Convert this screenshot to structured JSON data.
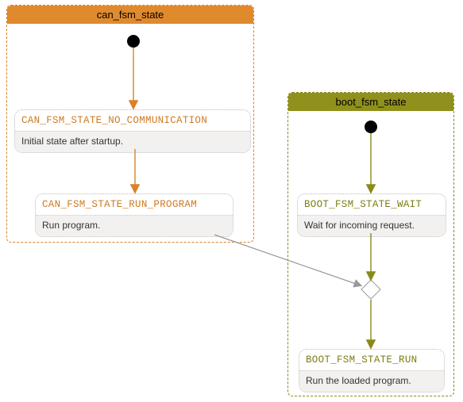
{
  "left_region": {
    "title": "can_fsm_state",
    "state1": {
      "name": "CAN_FSM_STATE_NO_COMMUNICATION",
      "desc": "Initial state after startup."
    },
    "state2": {
      "name": "CAN_FSM_STATE_RUN_PROGRAM",
      "desc": "Run program."
    }
  },
  "right_region": {
    "title": "boot_fsm_state",
    "state1": {
      "name": "BOOT_FSM_STATE_WAIT",
      "desc": "Wait for incoming request."
    },
    "state2": {
      "name": "BOOT_FSM_STATE_RUN",
      "desc": "Run the loaded program."
    }
  },
  "colors": {
    "can": "#d8822a",
    "boot": "#8a8a1a",
    "gray": "#999999"
  },
  "chart_data": {
    "type": "state-diagram",
    "regions": [
      {
        "name": "can_fsm_state",
        "initial": true,
        "states": [
          {
            "id": "CAN_FSM_STATE_NO_COMMUNICATION",
            "label": "Initial state after startup."
          },
          {
            "id": "CAN_FSM_STATE_RUN_PROGRAM",
            "label": "Run program."
          }
        ],
        "transitions": [
          {
            "from": "__initial__",
            "to": "CAN_FSM_STATE_NO_COMMUNICATION"
          },
          {
            "from": "CAN_FSM_STATE_NO_COMMUNICATION",
            "to": "CAN_FSM_STATE_RUN_PROGRAM"
          }
        ]
      },
      {
        "name": "boot_fsm_state",
        "initial": true,
        "states": [
          {
            "id": "BOOT_FSM_STATE_WAIT",
            "label": "Wait for incoming request."
          },
          {
            "id": "BOOT_FSM_STATE_RUN",
            "label": "Run the loaded program."
          }
        ],
        "transitions": [
          {
            "from": "__initial__",
            "to": "BOOT_FSM_STATE_WAIT"
          },
          {
            "from": "BOOT_FSM_STATE_WAIT",
            "to": "__decision__"
          },
          {
            "from": "__decision__",
            "to": "BOOT_FSM_STATE_RUN"
          }
        ]
      }
    ],
    "cross_region_transitions": [
      {
        "from": "CAN_FSM_STATE_RUN_PROGRAM",
        "to": "boot_fsm_state.__decision__"
      }
    ]
  }
}
